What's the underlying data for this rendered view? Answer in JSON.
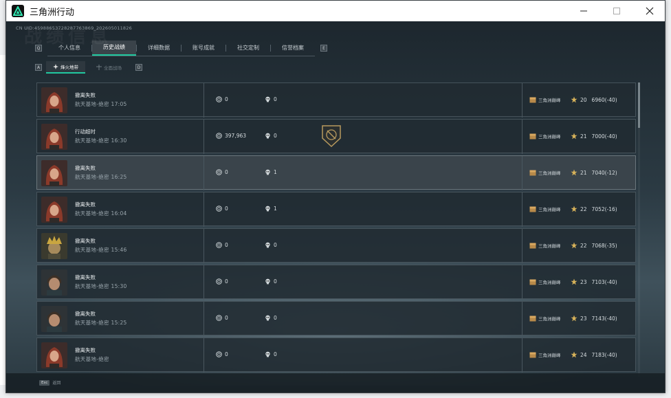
{
  "window": {
    "title": "三角洲行动"
  },
  "header": {
    "uid": "CN UID:4598865372828776386​9_20260501182​6",
    "watermark": "战绩信息"
  },
  "tabs": [
    {
      "label": "个人信息",
      "active": false
    },
    {
      "label": "历史战绩",
      "active": true
    },
    {
      "label": "详细数据",
      "active": false
    },
    {
      "label": "账号成就",
      "active": false
    },
    {
      "label": "社交定制",
      "active": false
    },
    {
      "label": "信誉档案",
      "active": false
    }
  ],
  "key_hints": {
    "prev_tab": "Q",
    "next_tab": "E",
    "prev_sub": "A",
    "next_sub": "D"
  },
  "subtabs": [
    {
      "label": "烽火地带",
      "active": true
    },
    {
      "label": "全面战场",
      "active": false
    }
  ],
  "matches": [
    {
      "status": "撤离失败",
      "map": "航天基地-绝密",
      "time": "17:05",
      "money": "0",
      "kills": "0",
      "mode": "三角洲巅峰",
      "level": "20",
      "score": "6960(-40)",
      "avatar": "red-hair",
      "highlight": false,
      "badge": false
    },
    {
      "status": "行动超时",
      "map": "航天基地-绝密",
      "time": "16:30",
      "money": "397,963",
      "kills": "0",
      "mode": "三角洲巅峰",
      "level": "21",
      "score": "7000(-40)",
      "avatar": "red-hair",
      "highlight": false,
      "badge": true
    },
    {
      "status": "撤离失败",
      "map": "航天基地-绝密",
      "time": "16:25",
      "money": "0",
      "kills": "1",
      "mode": "三角洲巅峰",
      "level": "21",
      "score": "7040(-12)",
      "avatar": "red-hair",
      "highlight": true,
      "badge": false
    },
    {
      "status": "撤离失败",
      "map": "航天基地-绝密",
      "time": "16:04",
      "money": "0",
      "kills": "1",
      "mode": "三角洲巅峰",
      "level": "22",
      "score": "7052(-16)",
      "avatar": "red-hair",
      "highlight": false,
      "badge": false
    },
    {
      "status": "撤离失败",
      "map": "航天基地-绝密",
      "time": "15:46",
      "money": "0",
      "kills": "0",
      "mode": "三角洲巅峰",
      "level": "22",
      "score": "7068(-35)",
      "avatar": "gold-helmet",
      "highlight": false,
      "badge": false
    },
    {
      "status": "撤离失败",
      "map": "航天基地-绝密",
      "time": "15:30",
      "money": "0",
      "kills": "0",
      "mode": "三角洲巅峰",
      "level": "23",
      "score": "7103(-40)",
      "avatar": "man",
      "highlight": false,
      "badge": false
    },
    {
      "status": "撤离失败",
      "map": "航天基地-绝密",
      "time": "15:25",
      "money": "0",
      "kills": "0",
      "mode": "三角洲巅峰",
      "level": "23",
      "score": "7143(-40)",
      "avatar": "man",
      "highlight": false,
      "badge": false
    },
    {
      "status": "撤离失败",
      "map": "航天基地-绝密",
      "time": "",
      "money": "0",
      "kills": "0",
      "mode": "三角洲巅峰",
      "level": "24",
      "score": "7183(-40)",
      "avatar": "red-hair",
      "highlight": false,
      "badge": false
    }
  ],
  "footer": {
    "esc_key": "Esc",
    "esc_label": "返回"
  },
  "colors": {
    "accent": "#21c9a0",
    "row_bg": "#212b32",
    "text": "#e8ecee"
  }
}
